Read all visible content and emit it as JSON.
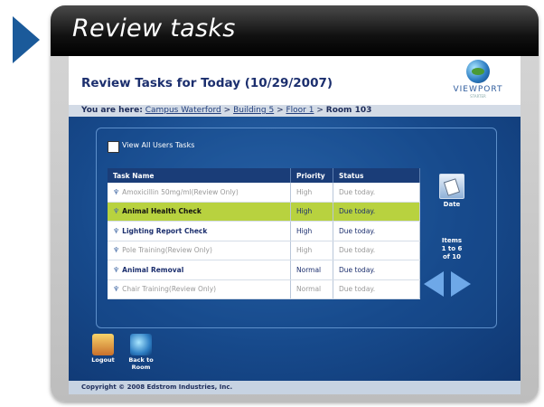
{
  "window": {
    "title": "Review tasks"
  },
  "header": {
    "heading": "Review Tasks for Today (10/29/2007)"
  },
  "logo": {
    "wordmark": "VIEWPORT",
    "tagline": "STARTER"
  },
  "breadcrumb": {
    "label": "You are here:",
    "campus": "Campus Waterford",
    "building": "Building 5",
    "floor": "Floor 1",
    "room": "Room 103",
    "sep": ">"
  },
  "filter": {
    "view_all_label": "View All Users Tasks",
    "checked": false
  },
  "table": {
    "columns": [
      "Task Name",
      "Priority",
      "Status"
    ],
    "rows": [
      {
        "name": "Amoxicillin 50mg/ml(Review Only)",
        "priority": "High",
        "status": "Due today."
      },
      {
        "name": "Animal Health Check",
        "priority": "High",
        "status": "Due today."
      },
      {
        "name": "Lighting Report Check",
        "priority": "High",
        "status": "Due today."
      },
      {
        "name": "Pole Training(Review Only)",
        "priority": "High",
        "status": "Due today."
      },
      {
        "name": "Animal Removal",
        "priority": "Normal",
        "status": "Due today."
      },
      {
        "name": "Chair Training(Review Only)",
        "priority": "Normal",
        "status": "Due today."
      }
    ]
  },
  "sidebar": {
    "date_label": "Date",
    "items_line1": "Items",
    "items_line2": "1 to 6",
    "items_line3": "of 10"
  },
  "bottom": {
    "logout_label": "Logout",
    "back_label_1": "Back to",
    "back_label_2": "Room"
  },
  "footer": {
    "copyright": "Copyright © 2008 Edstrom Industries, Inc."
  },
  "colors": {
    "selected_row": "#b8d23f",
    "header_text": "#1c2f6e",
    "accent": "#174a8c"
  }
}
